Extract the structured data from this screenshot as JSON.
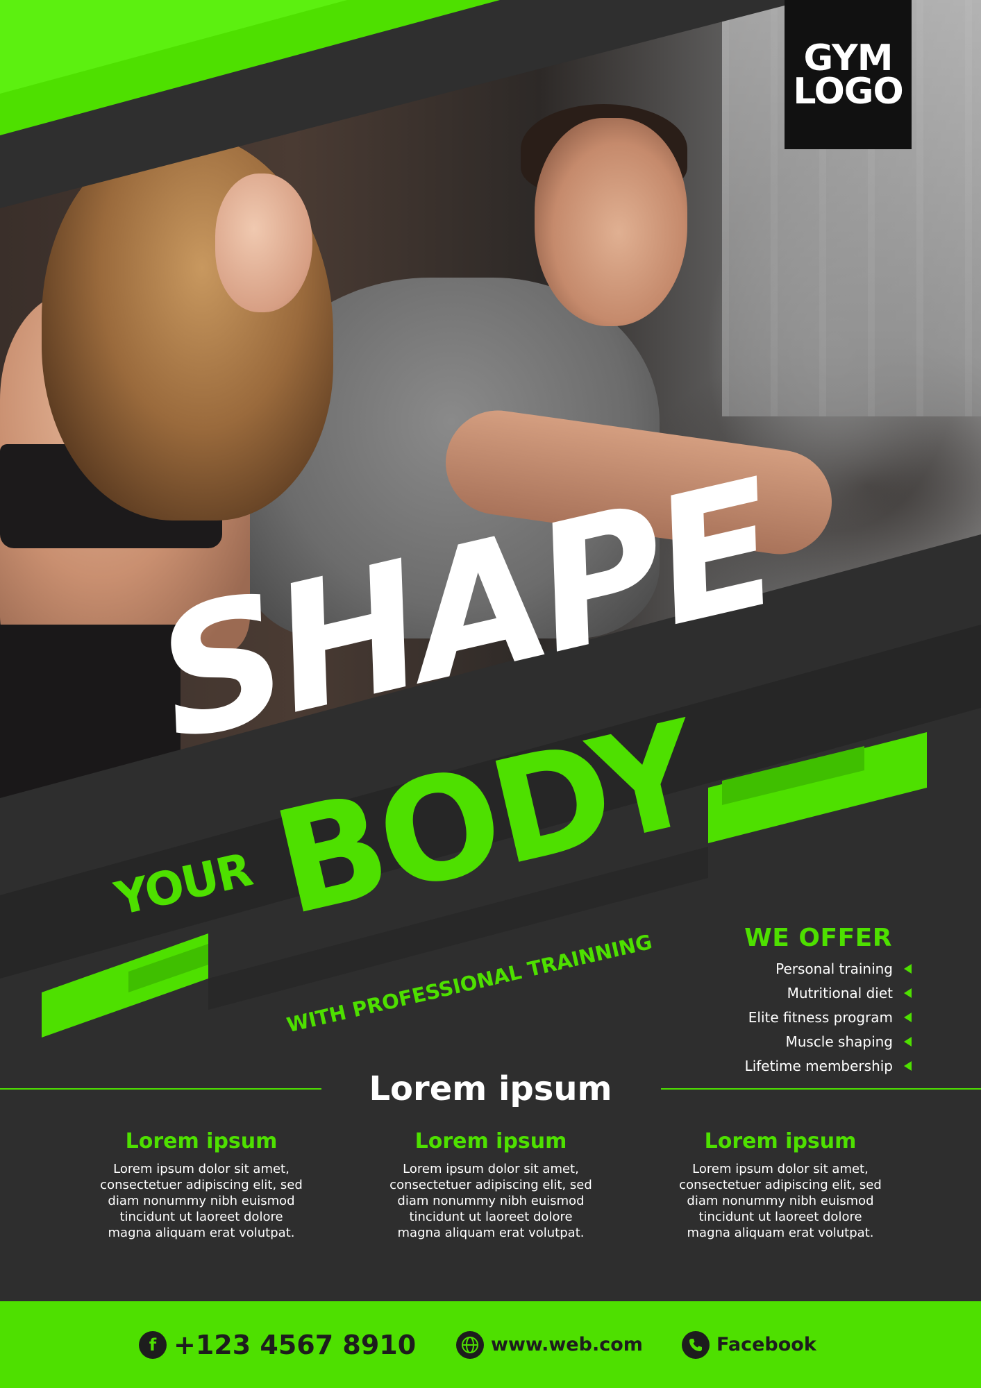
{
  "logo": {
    "line1": "GYM",
    "line2": "LOGO"
  },
  "headline": {
    "word1": "SHAPE",
    "word2": "YOUR",
    "word3": "BODY",
    "subtitle": "WITH PROFESSIONAL TRAINNING"
  },
  "offer": {
    "title": "WE OFFER",
    "items": [
      "Personal training",
      "Mutritional diet",
      "Elite fitness program",
      "Muscle shaping",
      "Lifetime membership"
    ]
  },
  "info": {
    "title": "Lorem ipsum",
    "columns": [
      {
        "title": "Lorem ipsum",
        "lines": [
          "Lorem ipsum dolor sit amet,",
          "consectetuer adipiscing elit, sed",
          "diam nonummy nibh euismod",
          "tincidunt ut laoreet dolore",
          "magna aliquam erat volutpat."
        ]
      },
      {
        "title": "Lorem ipsum",
        "lines": [
          "Lorem ipsum dolor sit amet,",
          "consectetuer adipiscing elit, sed",
          "diam nonummy nibh euismod",
          "tincidunt ut laoreet dolore",
          "magna aliquam erat volutpat."
        ]
      },
      {
        "title": "Lorem ipsum",
        "lines": [
          "Lorem ipsum dolor sit amet,",
          "consectetuer adipiscing elit, sed",
          "diam nonummy nibh euismod",
          "tincidunt ut laoreet dolore",
          "magna aliquam erat volutpat."
        ]
      }
    ]
  },
  "footer": {
    "phone": "+123 4567 8910",
    "website": "www.web.com",
    "social": "Facebook"
  },
  "colors": {
    "accent": "#4ee000",
    "dark": "#2e2e2e",
    "text": "#ffffff"
  }
}
